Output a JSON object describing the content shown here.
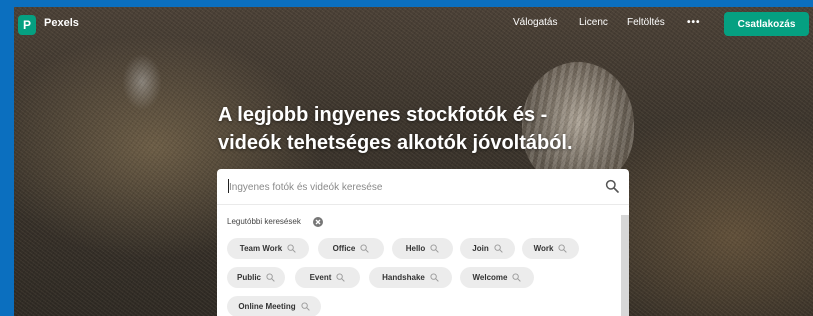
{
  "nav": {
    "logo_letter": "P",
    "brand": "Pexels",
    "links": [
      "Válogatás",
      "Licenc",
      "Feltöltés"
    ],
    "more": "•••",
    "join_label": "Csatlakozás"
  },
  "hero": {
    "line1": "A legjobb ingyenes stockfotók és -",
    "line2": "videók tehetséges alkotók jóvoltából."
  },
  "search": {
    "placeholder": "Ingyenes fotók és videók keresése"
  },
  "recent": {
    "label": "Legutóbbi keresések",
    "chips": [
      "Team Work",
      "Office",
      "Hello",
      "Join",
      "Work",
      "Public",
      "Event",
      "Handshake",
      "Welcome",
      "Online Meeting"
    ]
  },
  "colors": {
    "brand": "#05a081",
    "border_blue": "#0b6fbf"
  }
}
